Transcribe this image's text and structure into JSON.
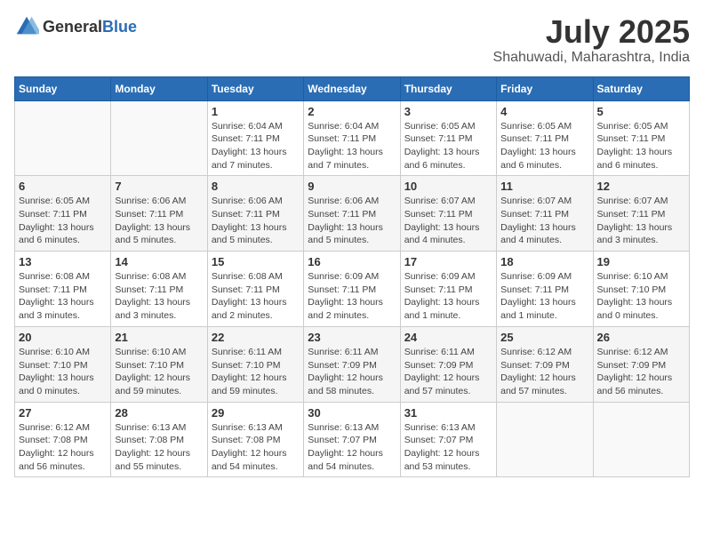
{
  "logo": {
    "text_general": "General",
    "text_blue": "Blue"
  },
  "title": "July 2025",
  "subtitle": "Shahuwadi, Maharashtra, India",
  "days_of_week": [
    "Sunday",
    "Monday",
    "Tuesday",
    "Wednesday",
    "Thursday",
    "Friday",
    "Saturday"
  ],
  "weeks": [
    [
      {
        "day": "",
        "info": ""
      },
      {
        "day": "",
        "info": ""
      },
      {
        "day": "1",
        "info": "Sunrise: 6:04 AM\nSunset: 7:11 PM\nDaylight: 13 hours and 7 minutes."
      },
      {
        "day": "2",
        "info": "Sunrise: 6:04 AM\nSunset: 7:11 PM\nDaylight: 13 hours and 7 minutes."
      },
      {
        "day": "3",
        "info": "Sunrise: 6:05 AM\nSunset: 7:11 PM\nDaylight: 13 hours and 6 minutes."
      },
      {
        "day": "4",
        "info": "Sunrise: 6:05 AM\nSunset: 7:11 PM\nDaylight: 13 hours and 6 minutes."
      },
      {
        "day": "5",
        "info": "Sunrise: 6:05 AM\nSunset: 7:11 PM\nDaylight: 13 hours and 6 minutes."
      }
    ],
    [
      {
        "day": "6",
        "info": "Sunrise: 6:05 AM\nSunset: 7:11 PM\nDaylight: 13 hours and 6 minutes."
      },
      {
        "day": "7",
        "info": "Sunrise: 6:06 AM\nSunset: 7:11 PM\nDaylight: 13 hours and 5 minutes."
      },
      {
        "day": "8",
        "info": "Sunrise: 6:06 AM\nSunset: 7:11 PM\nDaylight: 13 hours and 5 minutes."
      },
      {
        "day": "9",
        "info": "Sunrise: 6:06 AM\nSunset: 7:11 PM\nDaylight: 13 hours and 5 minutes."
      },
      {
        "day": "10",
        "info": "Sunrise: 6:07 AM\nSunset: 7:11 PM\nDaylight: 13 hours and 4 minutes."
      },
      {
        "day": "11",
        "info": "Sunrise: 6:07 AM\nSunset: 7:11 PM\nDaylight: 13 hours and 4 minutes."
      },
      {
        "day": "12",
        "info": "Sunrise: 6:07 AM\nSunset: 7:11 PM\nDaylight: 13 hours and 3 minutes."
      }
    ],
    [
      {
        "day": "13",
        "info": "Sunrise: 6:08 AM\nSunset: 7:11 PM\nDaylight: 13 hours and 3 minutes."
      },
      {
        "day": "14",
        "info": "Sunrise: 6:08 AM\nSunset: 7:11 PM\nDaylight: 13 hours and 3 minutes."
      },
      {
        "day": "15",
        "info": "Sunrise: 6:08 AM\nSunset: 7:11 PM\nDaylight: 13 hours and 2 minutes."
      },
      {
        "day": "16",
        "info": "Sunrise: 6:09 AM\nSunset: 7:11 PM\nDaylight: 13 hours and 2 minutes."
      },
      {
        "day": "17",
        "info": "Sunrise: 6:09 AM\nSunset: 7:11 PM\nDaylight: 13 hours and 1 minute."
      },
      {
        "day": "18",
        "info": "Sunrise: 6:09 AM\nSunset: 7:11 PM\nDaylight: 13 hours and 1 minute."
      },
      {
        "day": "19",
        "info": "Sunrise: 6:10 AM\nSunset: 7:10 PM\nDaylight: 13 hours and 0 minutes."
      }
    ],
    [
      {
        "day": "20",
        "info": "Sunrise: 6:10 AM\nSunset: 7:10 PM\nDaylight: 13 hours and 0 minutes."
      },
      {
        "day": "21",
        "info": "Sunrise: 6:10 AM\nSunset: 7:10 PM\nDaylight: 12 hours and 59 minutes."
      },
      {
        "day": "22",
        "info": "Sunrise: 6:11 AM\nSunset: 7:10 PM\nDaylight: 12 hours and 59 minutes."
      },
      {
        "day": "23",
        "info": "Sunrise: 6:11 AM\nSunset: 7:09 PM\nDaylight: 12 hours and 58 minutes."
      },
      {
        "day": "24",
        "info": "Sunrise: 6:11 AM\nSunset: 7:09 PM\nDaylight: 12 hours and 57 minutes."
      },
      {
        "day": "25",
        "info": "Sunrise: 6:12 AM\nSunset: 7:09 PM\nDaylight: 12 hours and 57 minutes."
      },
      {
        "day": "26",
        "info": "Sunrise: 6:12 AM\nSunset: 7:09 PM\nDaylight: 12 hours and 56 minutes."
      }
    ],
    [
      {
        "day": "27",
        "info": "Sunrise: 6:12 AM\nSunset: 7:08 PM\nDaylight: 12 hours and 56 minutes."
      },
      {
        "day": "28",
        "info": "Sunrise: 6:13 AM\nSunset: 7:08 PM\nDaylight: 12 hours and 55 minutes."
      },
      {
        "day": "29",
        "info": "Sunrise: 6:13 AM\nSunset: 7:08 PM\nDaylight: 12 hours and 54 minutes."
      },
      {
        "day": "30",
        "info": "Sunrise: 6:13 AM\nSunset: 7:07 PM\nDaylight: 12 hours and 54 minutes."
      },
      {
        "day": "31",
        "info": "Sunrise: 6:13 AM\nSunset: 7:07 PM\nDaylight: 12 hours and 53 minutes."
      },
      {
        "day": "",
        "info": ""
      },
      {
        "day": "",
        "info": ""
      }
    ]
  ]
}
